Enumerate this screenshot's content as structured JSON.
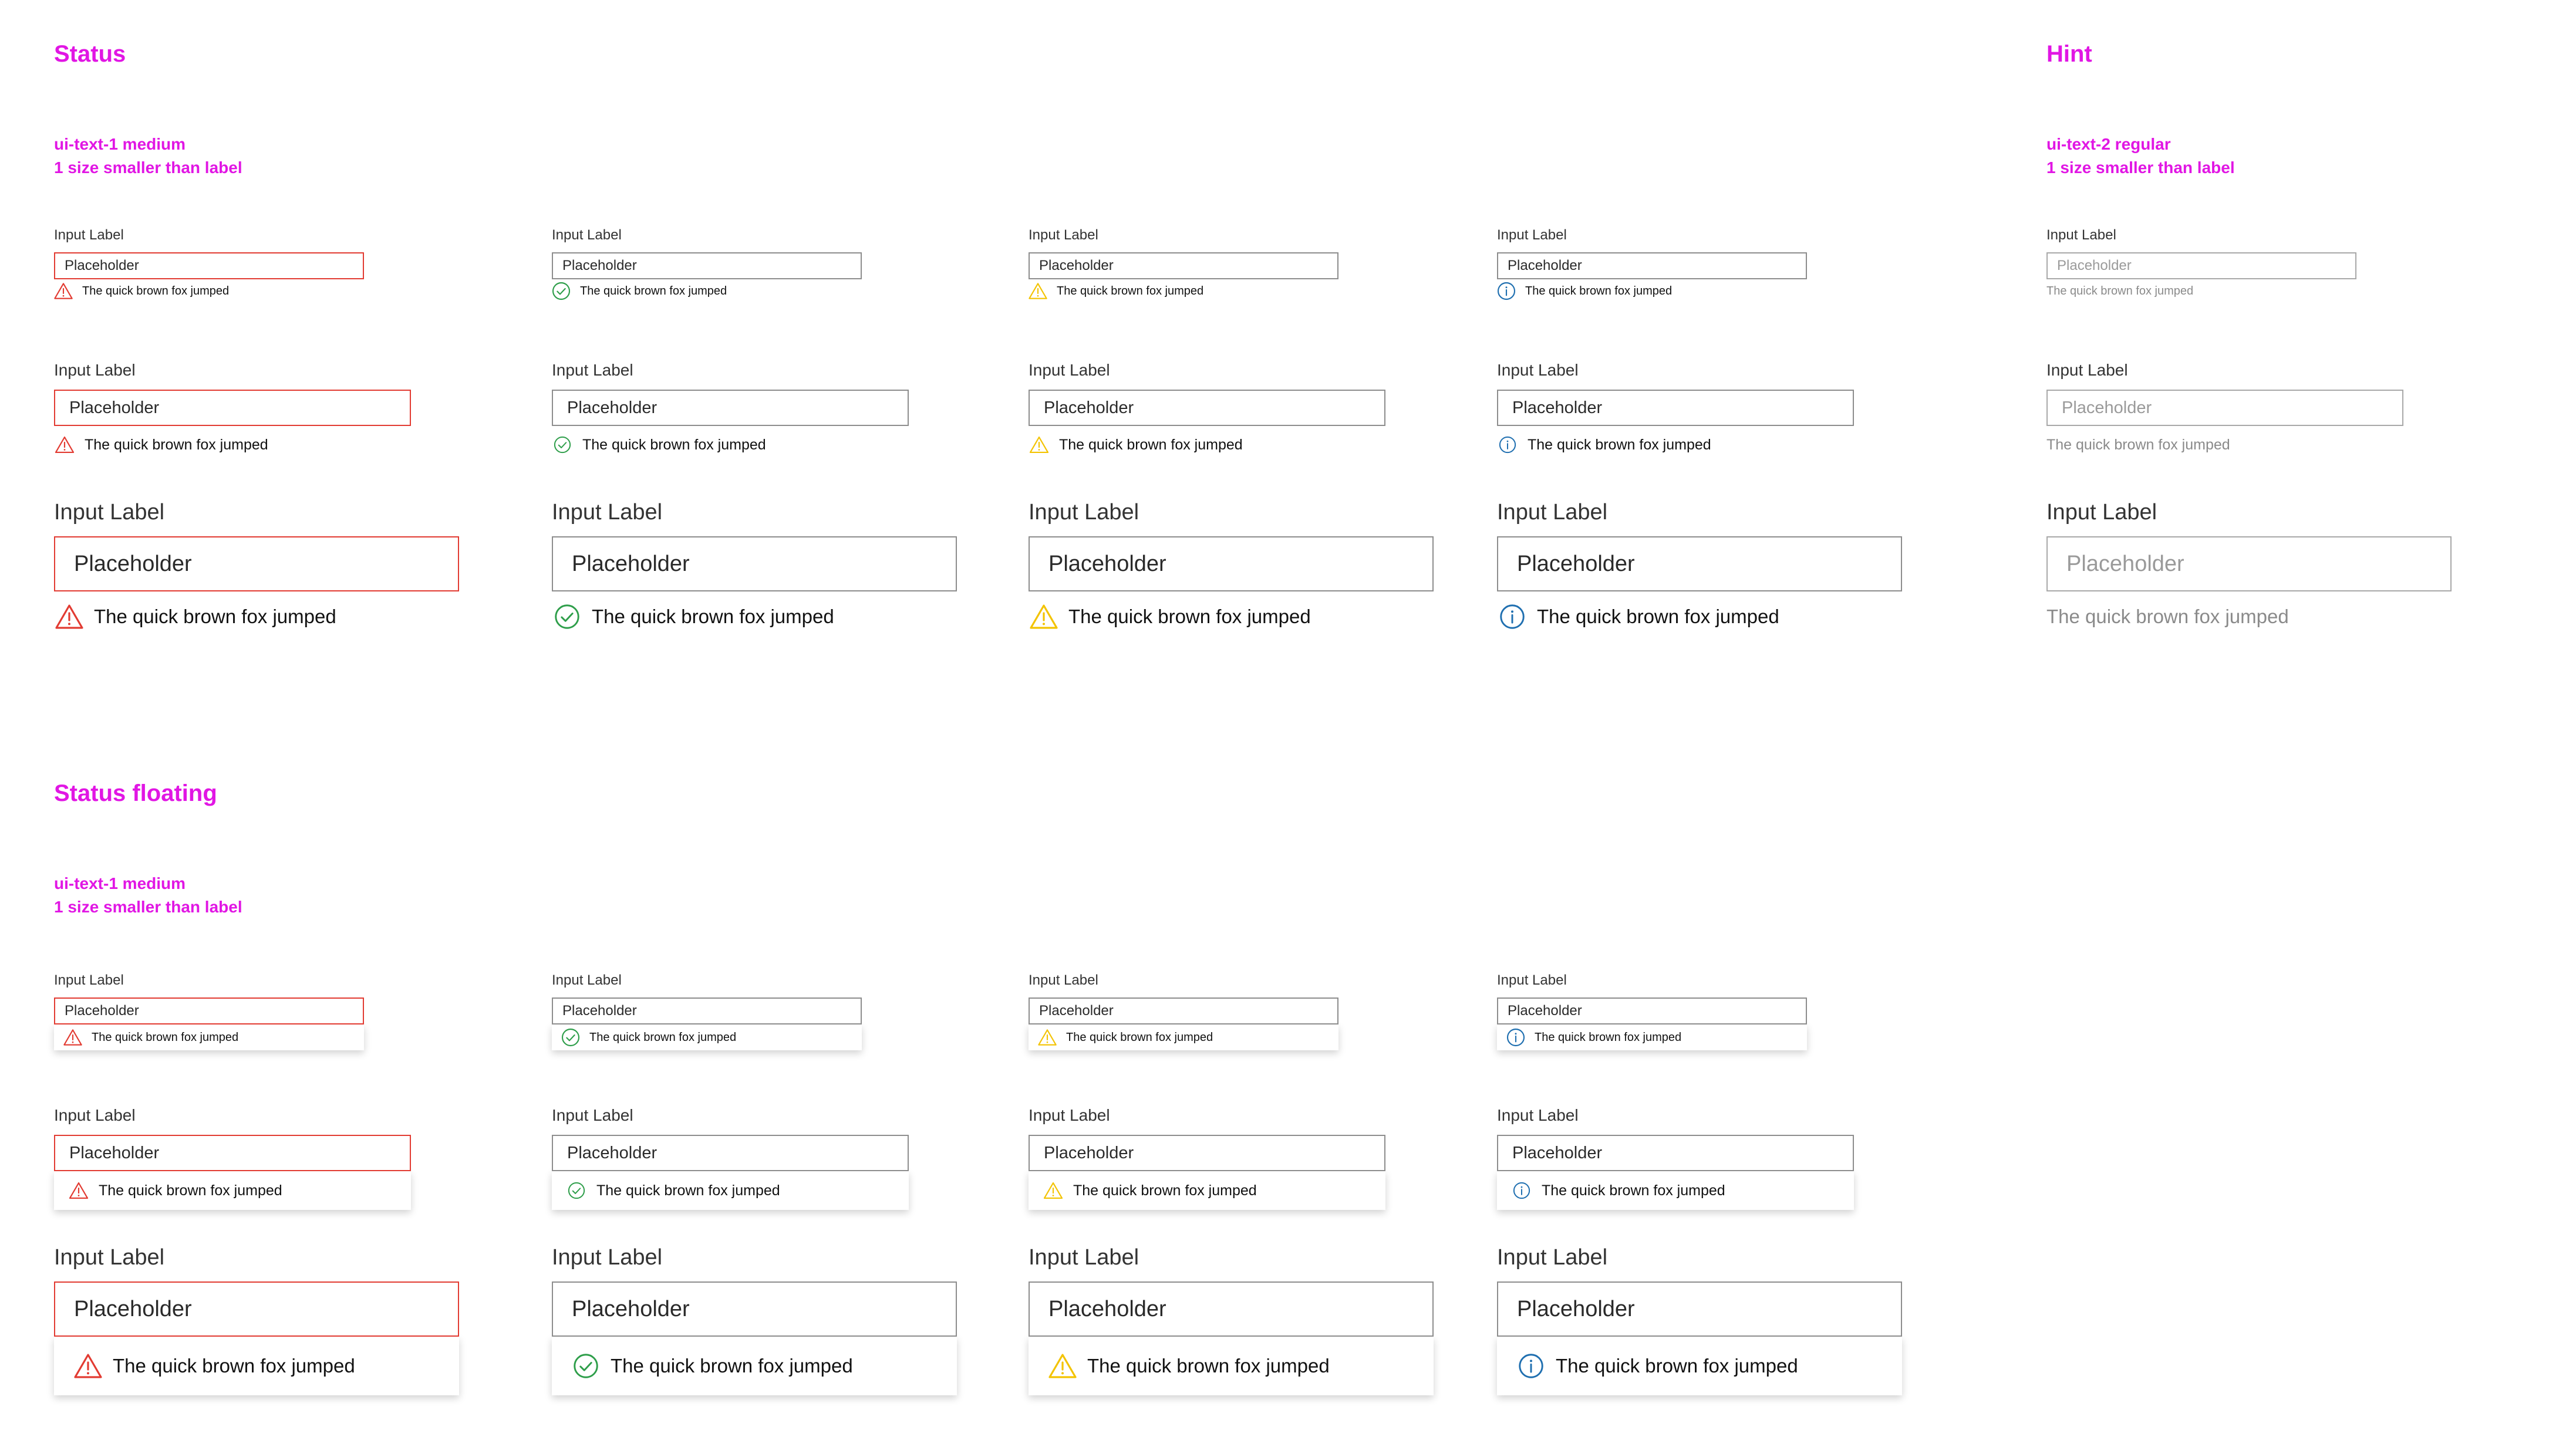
{
  "sections": {
    "status": {
      "title": "Status",
      "note_line1": "ui-text-1 medium",
      "note_line2": "1 size smaller than label"
    },
    "hint": {
      "title": "Hint",
      "note_line1": "ui-text-2 regular",
      "note_line2": "1 size smaller than label"
    },
    "status_floating": {
      "title": "Status floating",
      "note_line1": "ui-text-1 medium",
      "note_line2": "1 size smaller than label"
    }
  },
  "field": {
    "label": "Input Label",
    "placeholder": "Placeholder",
    "message": "The quick brown fox jumped"
  },
  "variants": [
    {
      "kind": "error",
      "icon": "warning-triangle-icon",
      "color": "#e23b32"
    },
    {
      "kind": "success",
      "icon": "check-circle-icon",
      "color": "#2e9e4a"
    },
    {
      "kind": "warning",
      "icon": "warning-triangle-icon",
      "color": "#f3c300"
    },
    {
      "kind": "info",
      "icon": "info-circle-icon",
      "color": "#1f6fb0"
    },
    {
      "kind": "hint",
      "icon": "",
      "color": "#8a8a8a"
    }
  ],
  "colors": {
    "annotation": "#e116e4",
    "border_default": "#8d8d8d",
    "border_error": "#e23b32",
    "hint_text": "#8a8a8a"
  }
}
